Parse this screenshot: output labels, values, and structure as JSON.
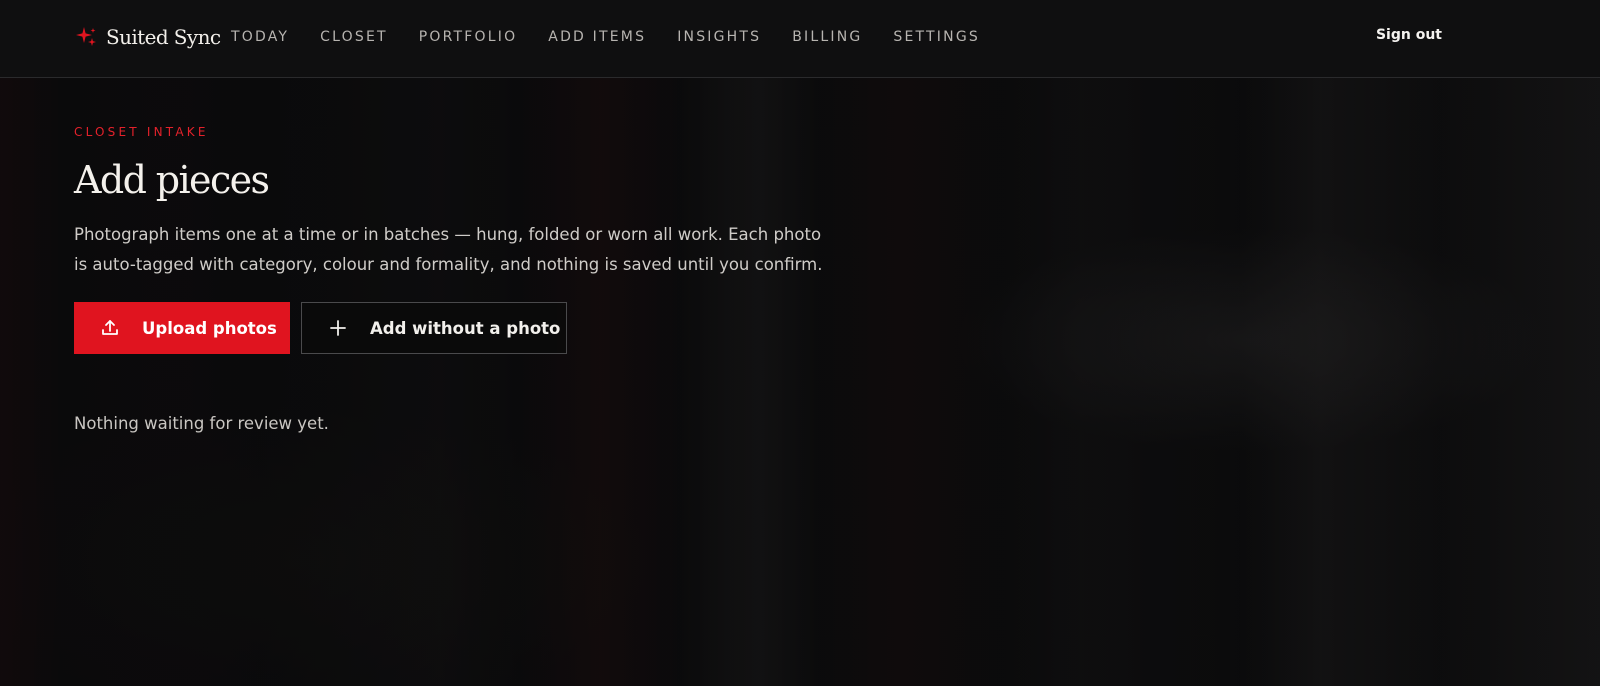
{
  "app": {
    "brand_name": "Suited Sync",
    "accent_color": "#e0141f"
  },
  "nav": {
    "items": [
      {
        "label": "TODAY"
      },
      {
        "label": "CLOSET"
      },
      {
        "label": "PORTFOLIO"
      },
      {
        "label": "ADD ITEMS"
      },
      {
        "label": "INSIGHTS"
      },
      {
        "label": "BILLING"
      },
      {
        "label": "SETTINGS"
      }
    ],
    "signout_label": "Sign out"
  },
  "main": {
    "eyebrow": "CLOSET INTAKE",
    "title": "Add pieces",
    "description": "Photograph items one at a time or in batches — hung, folded or worn all work. Each photo is auto-tagged with category, colour and formality, and nothing is saved until you confirm.",
    "upload_button": {
      "label": "Upload photos",
      "icon": "upload-icon"
    },
    "manual_button": {
      "label": "Add without a photo",
      "icon": "plus-icon"
    },
    "empty_state": "Nothing waiting for review yet."
  }
}
